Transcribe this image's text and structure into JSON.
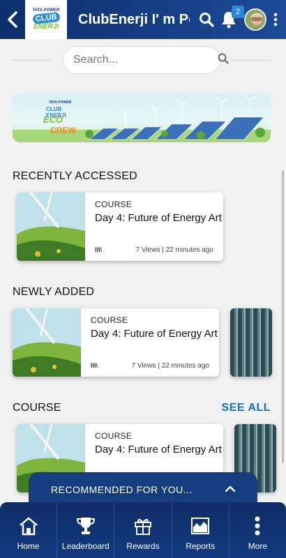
{
  "header": {
    "back_icon": "back-arrow-icon",
    "logo_line1": "TATA POWER",
    "logo_line2": "CLUB",
    "logo_line3": "ENERJI",
    "title": "ClubEnerji I' m Po...",
    "notification_count": "2"
  },
  "search": {
    "placeholder": "Search..."
  },
  "banner": {
    "line1": "TATA POWER",
    "line2": "CLUB ENERJI",
    "line3": "ECO",
    "line4": "CREW"
  },
  "sections": {
    "recent": {
      "title": "RECENTLY ACCESSED",
      "card": {
        "type": "COURSE",
        "name": "Day 4: Future of Energy Art",
        "meta": "7 Views | 22 minutes ago",
        "lib": "lll\\"
      }
    },
    "new": {
      "title": "NEWLY ADDED",
      "card": {
        "type": "COURSE",
        "name": "Day 4: Future of Energy Art",
        "meta": "7 Views | 22 minutes ago",
        "lib": "lll\\"
      }
    },
    "course": {
      "title": "COURSE",
      "see_all": "SEE ALL",
      "card": {
        "type": "COURSE",
        "name": "Day 4: Future of Energy Art"
      }
    }
  },
  "recommended": {
    "label": "RECOMMENDED FOR YOU..."
  },
  "bottom_nav": [
    {
      "label": "Home",
      "icon": "home-icon"
    },
    {
      "label": "Leaderboard",
      "icon": "trophy-icon"
    },
    {
      "label": "Rewards",
      "icon": "gift-icon"
    },
    {
      "label": "Reports",
      "icon": "chart-icon"
    },
    {
      "label": "More",
      "icon": "more-icon"
    }
  ],
  "colors": {
    "header": "#163f86",
    "accent": "#1b6ec2",
    "badge": "#2f86d6",
    "nav": "#133a80"
  }
}
